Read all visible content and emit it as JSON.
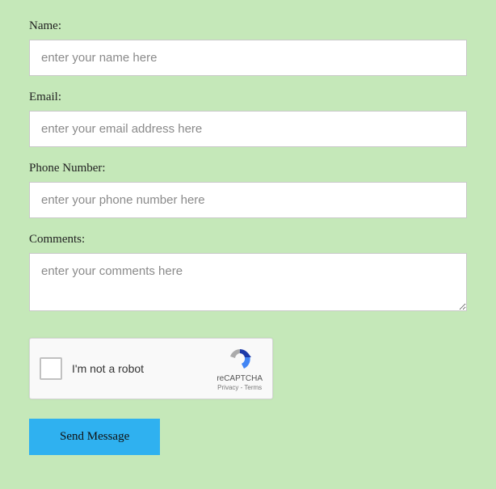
{
  "fields": {
    "name": {
      "label": "Name:",
      "placeholder": "enter your name here"
    },
    "email": {
      "label": "Email:",
      "placeholder": "enter your email address here"
    },
    "phone": {
      "label": "Phone Number:",
      "placeholder": "enter your phone number here"
    },
    "comments": {
      "label": "Comments:",
      "placeholder": "enter your comments here"
    }
  },
  "captcha": {
    "label": "I'm not a robot",
    "brand": "reCAPTCHA",
    "links": "Privacy - Terms"
  },
  "submit": {
    "label": "Send Message"
  }
}
